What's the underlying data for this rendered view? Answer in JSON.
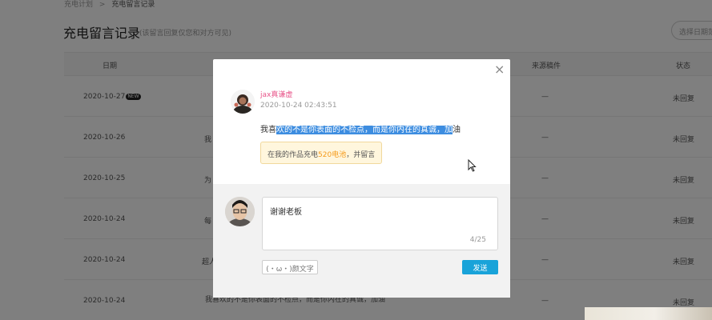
{
  "breadcrumb": {
    "parent": "充电计划",
    "separator": ">",
    "current": "充电留言记录"
  },
  "page": {
    "title": "充电留言记录",
    "subtitle": "(该留言回复仅您和对方可见)",
    "date_picker_placeholder": "选择日期范围"
  },
  "table": {
    "headers": {
      "date": "日期",
      "source": "来源稿件",
      "status": "状态"
    },
    "rows": [
      {
        "date": "2020-10-27",
        "badge": "NEW",
        "message": "",
        "source": "—",
        "status": "未回复"
      },
      {
        "date": "2020-10-26",
        "message": "我",
        "source": "—",
        "status": "未回复"
      },
      {
        "date": "2020-10-25",
        "message": "为",
        "source": "—",
        "status": "未回复"
      },
      {
        "date": "2020-10-24",
        "message": "每",
        "source": "—",
        "status": "未回复"
      },
      {
        "date": "2020-10-24",
        "message": "超人",
        "source": "—",
        "status": "未回复"
      },
      {
        "date": "2020-10-24",
        "message": "我喜欢的不是你表面的不检点，而是你内在的真诚，加油",
        "source": "—",
        "status": "未回复"
      }
    ]
  },
  "modal": {
    "close_icon": "×",
    "username": "jax真谦虚",
    "timestamp": "2020-10-24 02:43:51",
    "message_before": "我喜",
    "message_selected": "欢的不是你表面的不检点，而是你内在的真诚，加",
    "message_after": "油",
    "charge_prefix": "在我的作品充电",
    "charge_amount": "520电池",
    "charge_suffix": "，并留言",
    "reply_value": "谢谢老板",
    "reply_counter": "4/25",
    "emoji_button": "(・ω・)颜文字",
    "send_button": "发送"
  },
  "colors": {
    "accent": "#19a3d9",
    "username": "#e8558a",
    "charge_amount": "#f59a1a",
    "selection": "#3d8de0"
  }
}
